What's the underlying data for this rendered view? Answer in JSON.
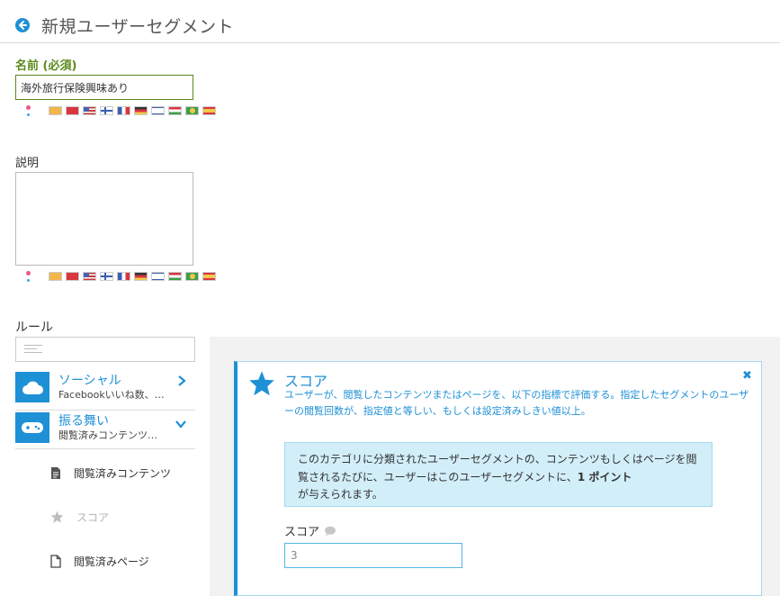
{
  "header": {
    "title": "新規ユーザーセグメント"
  },
  "name_field": {
    "label": "名前 (必須)",
    "value": "海外旅行保険興味あり"
  },
  "description_field": {
    "label": "説明",
    "value": ""
  },
  "flags": [
    "jp-icon",
    "eu",
    "cn",
    "us",
    "fi",
    "fr",
    "de",
    "il",
    "hu",
    "br",
    "es"
  ],
  "rules": {
    "label": "ルール",
    "search_placeholder": "",
    "categories": [
      {
        "title": "ソーシャル",
        "subtitle": "Facebookいいね数、…",
        "icon": "cloud-icon",
        "expanded": false
      },
      {
        "title": "振る舞い",
        "subtitle": "閲覧済みコンテンツ…",
        "icon": "gamepad-icon",
        "expanded": true
      }
    ],
    "items": [
      {
        "label": "閲覧済みコンテンツ",
        "icon": "document-icon",
        "disabled": false
      },
      {
        "label": "スコア",
        "icon": "star-icon",
        "disabled": true
      },
      {
        "label": "閲覧済みページ",
        "icon": "page-icon",
        "disabled": false
      }
    ]
  },
  "score_card": {
    "title": "スコア",
    "description": "ユーザーが、閲覧したコンテンツまたはページを、以下の指標で評価する。指定したセグメントのユーザーの閲覧回数が、指定値と等しい、もしくは設定済みしきい値以上。",
    "info_prefix": "このカテゴリに分類されたユーザーセグメントの、コンテンツもしくはページを閲覧されるたびに、ユーザーはこのユーザーセグメントに、",
    "info_bold": "1 ポイント",
    "info_suffix": "が与えられます。",
    "score_label": "スコア",
    "score_value": "3"
  },
  "colors": {
    "accent": "#1e90d6",
    "required_label": "#5a8a1c",
    "info_bg": "#d2eef9"
  }
}
